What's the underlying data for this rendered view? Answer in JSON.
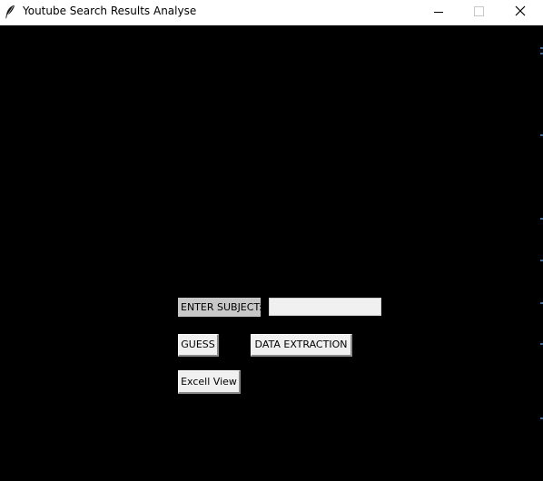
{
  "window": {
    "title": "Youtube Search Results Analyse",
    "icon": "feather-icon",
    "controls": {
      "minimize_icon": "minimize-icon",
      "maximize_icon": "maximize-icon",
      "close_icon": "close-icon"
    }
  },
  "form": {
    "subject_label": "ENTER SUBJECT:",
    "subject_value": "",
    "guess_label": "GUESS",
    "data_extraction_label": "DATA EXTRACTION",
    "excel_view_label": "Excell View"
  },
  "colors": {
    "background": "#000000",
    "titlebar": "#ffffff",
    "label_background": "#c8c8c8",
    "button_background": "#f0f0f0"
  }
}
